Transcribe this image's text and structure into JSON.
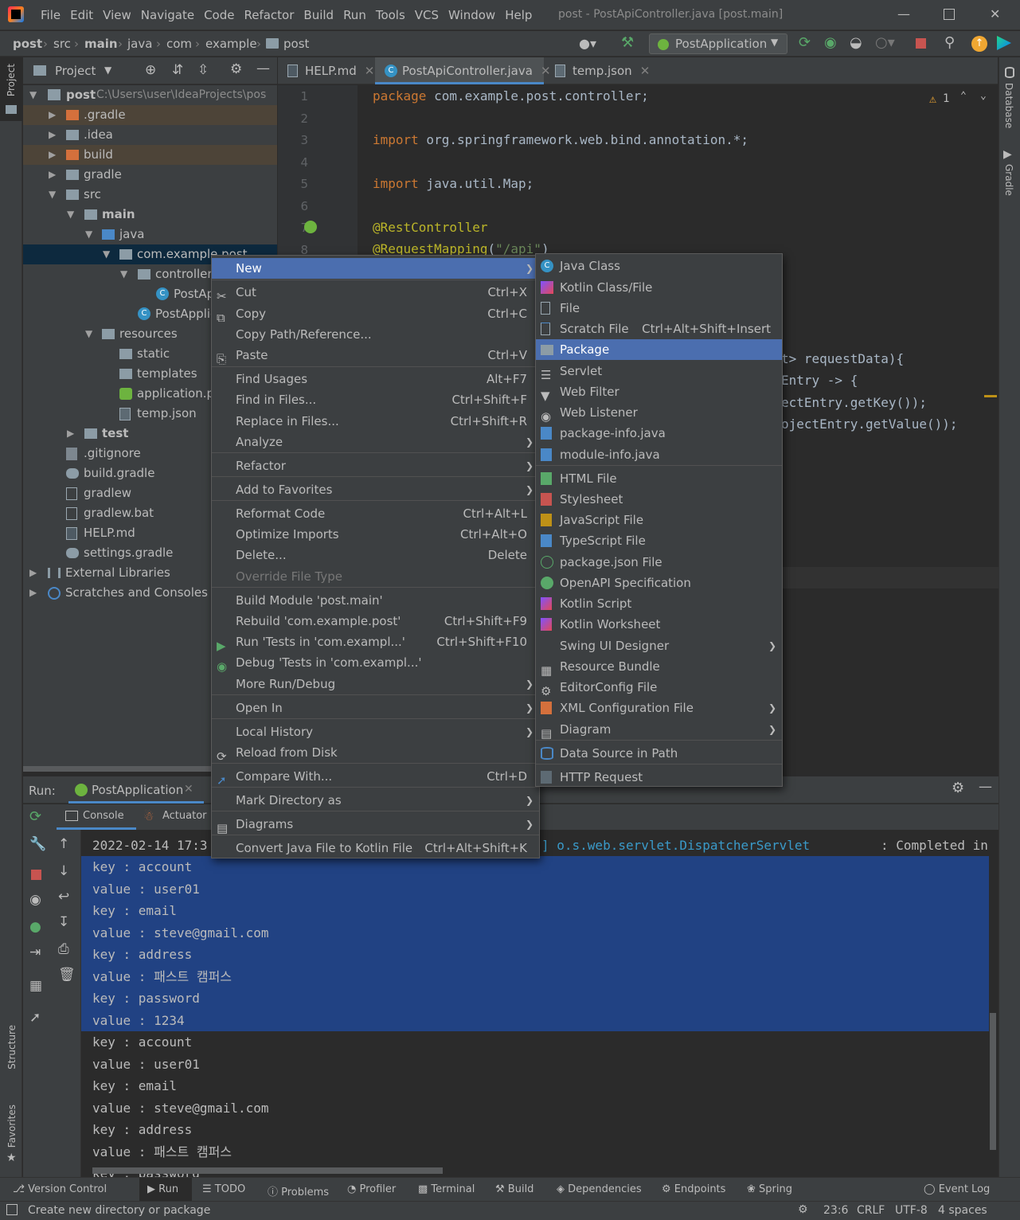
{
  "app": {
    "menu": [
      "File",
      "Edit",
      "View",
      "Navigate",
      "Code",
      "Refactor",
      "Build",
      "Run",
      "Tools",
      "VCS",
      "Window",
      "Help"
    ],
    "window_title": "post - PostApiController.java [post.main]"
  },
  "breadcrumbs": [
    "post",
    "src",
    "main",
    "java",
    "com",
    "example",
    "post"
  ],
  "run_config": "PostApplication",
  "project_panel": {
    "title": "Project",
    "tree": [
      {
        "label": "post",
        "extra": "C:\\Users\\user\\IdeaProjects\\pos"
      },
      {
        "label": ".gradle"
      },
      {
        "label": ".idea"
      },
      {
        "label": "build"
      },
      {
        "label": "gradle"
      },
      {
        "label": "src"
      },
      {
        "label": "main"
      },
      {
        "label": "java"
      },
      {
        "label": "com.example.post"
      },
      {
        "label": "controller"
      },
      {
        "label": "PostAp"
      },
      {
        "label": "PostApplic"
      },
      {
        "label": "resources"
      },
      {
        "label": "static"
      },
      {
        "label": "templates"
      },
      {
        "label": "application.pr"
      },
      {
        "label": "temp.json"
      },
      {
        "label": "test"
      },
      {
        "label": ".gitignore"
      },
      {
        "label": "build.gradle"
      },
      {
        "label": "gradlew"
      },
      {
        "label": "gradlew.bat"
      },
      {
        "label": "HELP.md"
      },
      {
        "label": "settings.gradle"
      },
      {
        "label": "External Libraries"
      },
      {
        "label": "Scratches and Consoles"
      }
    ]
  },
  "editor": {
    "tabs": [
      {
        "label": "HELP.md"
      },
      {
        "label": "PostApiController.java"
      },
      {
        "label": "temp.json"
      }
    ],
    "warnings": "1",
    "line_numbers": [
      "1",
      "2",
      "3",
      "4",
      "5",
      "6",
      "7",
      "8"
    ],
    "code": {
      "l1_kw": "package",
      "l1_rest": " com.example.post.controller;",
      "l3_kw": "import",
      "l3_rest": " org.springframework.web.bind.annotation.*;",
      "l5_kw": "import",
      "l5_rest": " java.util.Map;",
      "l7": "@RestController",
      "l8_an": "@RequestMapping",
      "l8_open": "(",
      "l8_str": "\"/api\"",
      "l8_close": ")",
      "frag1": "t> requestData){",
      "frag2": "Entry -> {",
      "frag3": "ectEntry.getKey());",
      "frag4": "ojectEntry.getValue());"
    }
  },
  "run_panel": {
    "label": "Run:",
    "tab": "PostApplication",
    "subtabs": [
      "Console",
      "Actuator"
    ],
    "log_prefix": "2022-02-14 17:3",
    "log_mid": "] o.s.web.servlet.DispatcherServlet",
    "log_end": ": Completed ini",
    "lines": [
      "key : account",
      "value : user01",
      "key : email",
      "value : steve@gmail.com",
      "key : address",
      "value : 패스트 캠퍼스",
      "key : password",
      "value : 1234",
      "key : account",
      "value : user01",
      "key : email",
      "value : steve@gmail.com",
      "key : address",
      "value : 패스트 캠퍼스",
      "key : password"
    ]
  },
  "context_menu": {
    "items": [
      {
        "label": "New",
        "shortcut": "",
        "submenu": true
      },
      {
        "label": "Cut",
        "shortcut": "Ctrl+X"
      },
      {
        "label": "Copy",
        "shortcut": "Ctrl+C"
      },
      {
        "label": "Copy Path/Reference...",
        "shortcut": ""
      },
      {
        "label": "Paste",
        "shortcut": "Ctrl+V"
      },
      {
        "label": "Find Usages",
        "shortcut": "Alt+F7"
      },
      {
        "label": "Find in Files...",
        "shortcut": "Ctrl+Shift+F"
      },
      {
        "label": "Replace in Files...",
        "shortcut": "Ctrl+Shift+R"
      },
      {
        "label": "Analyze",
        "shortcut": "",
        "submenu": true
      },
      {
        "label": "Refactor",
        "shortcut": "",
        "submenu": true
      },
      {
        "label": "Add to Favorites",
        "shortcut": "",
        "submenu": true
      },
      {
        "label": "Reformat Code",
        "shortcut": "Ctrl+Alt+L"
      },
      {
        "label": "Optimize Imports",
        "shortcut": "Ctrl+Alt+O"
      },
      {
        "label": "Delete...",
        "shortcut": "Delete"
      },
      {
        "label": "Override File Type",
        "shortcut": ""
      },
      {
        "label": "Build Module 'post.main'",
        "shortcut": ""
      },
      {
        "label": "Rebuild 'com.example.post'",
        "shortcut": "Ctrl+Shift+F9"
      },
      {
        "label": "Run 'Tests in 'com.exampl...'",
        "shortcut": "Ctrl+Shift+F10"
      },
      {
        "label": "Debug 'Tests in 'com.exampl...'",
        "shortcut": ""
      },
      {
        "label": "More Run/Debug",
        "shortcut": "",
        "submenu": true
      },
      {
        "label": "Open In",
        "shortcut": "",
        "submenu": true
      },
      {
        "label": "Local History",
        "shortcut": "",
        "submenu": true
      },
      {
        "label": "Reload from Disk",
        "shortcut": ""
      },
      {
        "label": "Compare With...",
        "shortcut": "Ctrl+D"
      },
      {
        "label": "Mark Directory as",
        "shortcut": "",
        "submenu": true
      },
      {
        "label": "Diagrams",
        "shortcut": "",
        "submenu": true
      },
      {
        "label": "Convert Java File to Kotlin File",
        "shortcut": "Ctrl+Alt+Shift+K"
      }
    ]
  },
  "new_submenu": {
    "items": [
      {
        "label": "Java Class"
      },
      {
        "label": "Kotlin Class/File"
      },
      {
        "label": "File"
      },
      {
        "label": "Scratch File",
        "shortcut": "Ctrl+Alt+Shift+Insert"
      },
      {
        "label": "Package"
      },
      {
        "label": "Servlet"
      },
      {
        "label": "Web Filter"
      },
      {
        "label": "Web Listener"
      },
      {
        "label": "package-info.java"
      },
      {
        "label": "module-info.java"
      },
      {
        "label": "HTML File"
      },
      {
        "label": "Stylesheet"
      },
      {
        "label": "JavaScript File"
      },
      {
        "label": "TypeScript File"
      },
      {
        "label": "package.json File"
      },
      {
        "label": "OpenAPI Specification"
      },
      {
        "label": "Kotlin Script"
      },
      {
        "label": "Kotlin Worksheet"
      },
      {
        "label": "Swing UI Designer",
        "submenu": true
      },
      {
        "label": "Resource Bundle"
      },
      {
        "label": "EditorConfig File"
      },
      {
        "label": "XML Configuration File",
        "submenu": true
      },
      {
        "label": "Diagram",
        "submenu": true
      },
      {
        "label": "Data Source in Path"
      },
      {
        "label": "HTTP Request"
      }
    ]
  },
  "side_tools": {
    "left_top": "Project",
    "left_structure": "Structure",
    "left_favorites": "Favorites",
    "right_database": "Database",
    "right_gradle": "Gradle"
  },
  "bottom_tools": [
    "Version Control",
    "Run",
    "TODO",
    "Problems",
    "Profiler",
    "Terminal",
    "Build",
    "Dependencies",
    "Endpoints",
    "Spring",
    "Event Log"
  ],
  "status": {
    "message": "Create new directory or package",
    "position": "23:6",
    "line_sep": "CRLF",
    "encoding": "UTF-8",
    "indent": "4 spaces"
  },
  "colors": {
    "accent": "#4b6eaf",
    "selection": "#214283",
    "keyword": "#cc7832",
    "annotation": "#bbb529",
    "string": "#6a8759"
  }
}
